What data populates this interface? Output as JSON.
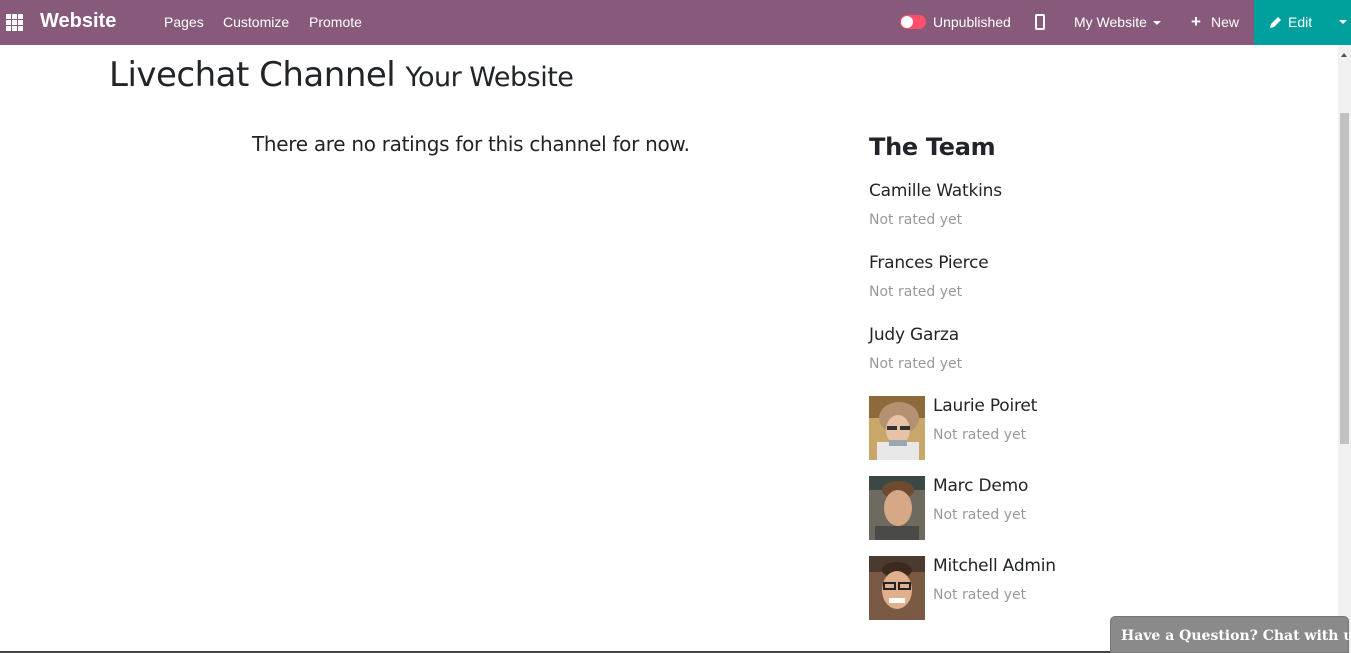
{
  "topbar": {
    "brand": "Website",
    "menu": [
      "Pages",
      "Customize",
      "Promote"
    ],
    "publish_status": "Unpublished",
    "website_selector": "My Website",
    "new_label": "New",
    "edit_label": "Edit",
    "colors": {
      "bar": "#875a7b",
      "edit": "#00a09d",
      "toggle": "#ff4f6a"
    }
  },
  "page": {
    "title": "Livechat Channel",
    "subtitle": "Your Website",
    "no_ratings": "There are no ratings for this channel for now."
  },
  "team": {
    "title": "The Team",
    "members": [
      {
        "name": "Camille Watkins",
        "rating": "Not rated yet",
        "has_avatar": false
      },
      {
        "name": "Frances Pierce",
        "rating": "Not rated yet",
        "has_avatar": false
      },
      {
        "name": "Judy Garza",
        "rating": "Not rated yet",
        "has_avatar": false
      },
      {
        "name": "Laurie Poiret",
        "rating": "Not rated yet",
        "has_avatar": true
      },
      {
        "name": "Marc Demo",
        "rating": "Not rated yet",
        "has_avatar": true
      },
      {
        "name": "Mitchell Admin",
        "rating": "Not rated yet",
        "has_avatar": true
      }
    ]
  },
  "chat_button": "Have a Question? Chat with us."
}
